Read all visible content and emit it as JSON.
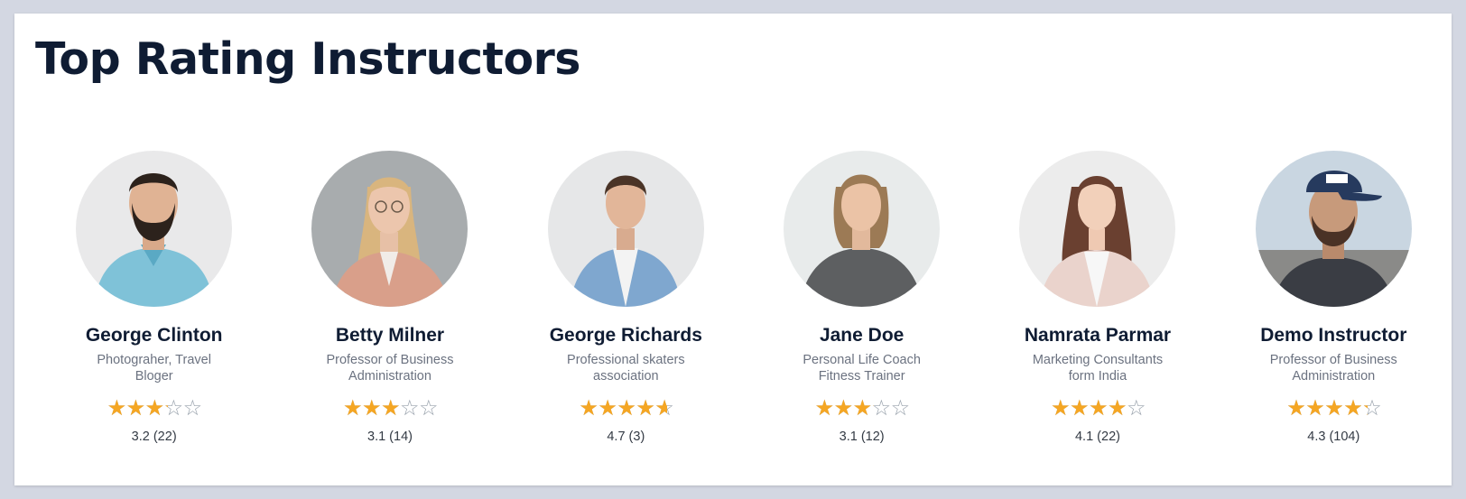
{
  "section": {
    "title": "Top Rating Instructors"
  },
  "colors": {
    "star_fill": "#f5a623",
    "star_empty": "#9aa3ad",
    "title": "#0f1c33",
    "page_bg": "#d3d7e2"
  },
  "instructors": [
    {
      "name": "George Clinton",
      "role": "Photograher, Travel Bloger",
      "rating": 3.2,
      "score_text": "3.2 (22)",
      "avatar_icon": "man-beard-blue-shirt"
    },
    {
      "name": "Betty Milner",
      "role": "Professor of Business Administration",
      "rating": 3.1,
      "score_text": "3.1 (14)",
      "avatar_icon": "woman-glasses-pink-blazer"
    },
    {
      "name": "George Richards",
      "role": "Professional skaters association",
      "rating": 4.7,
      "score_text": "4.7 (3)",
      "avatar_icon": "man-denim-shirt"
    },
    {
      "name": "Jane Doe",
      "role": "Personal Life Coach Fitness Trainer",
      "rating": 3.1,
      "score_text": "3.1 (12)",
      "avatar_icon": "woman-short-hair-grey-top"
    },
    {
      "name": "Namrata Parmar",
      "role": "Marketing Consultants form India",
      "rating": 4.1,
      "score_text": "4.1 (22)",
      "avatar_icon": "woman-long-hair-beige-blazer"
    },
    {
      "name": "Demo Instructor",
      "role": "Professor of Business Administration",
      "rating": 4.3,
      "score_text": "4.3 (104)",
      "avatar_icon": "man-cap-smiling"
    }
  ]
}
